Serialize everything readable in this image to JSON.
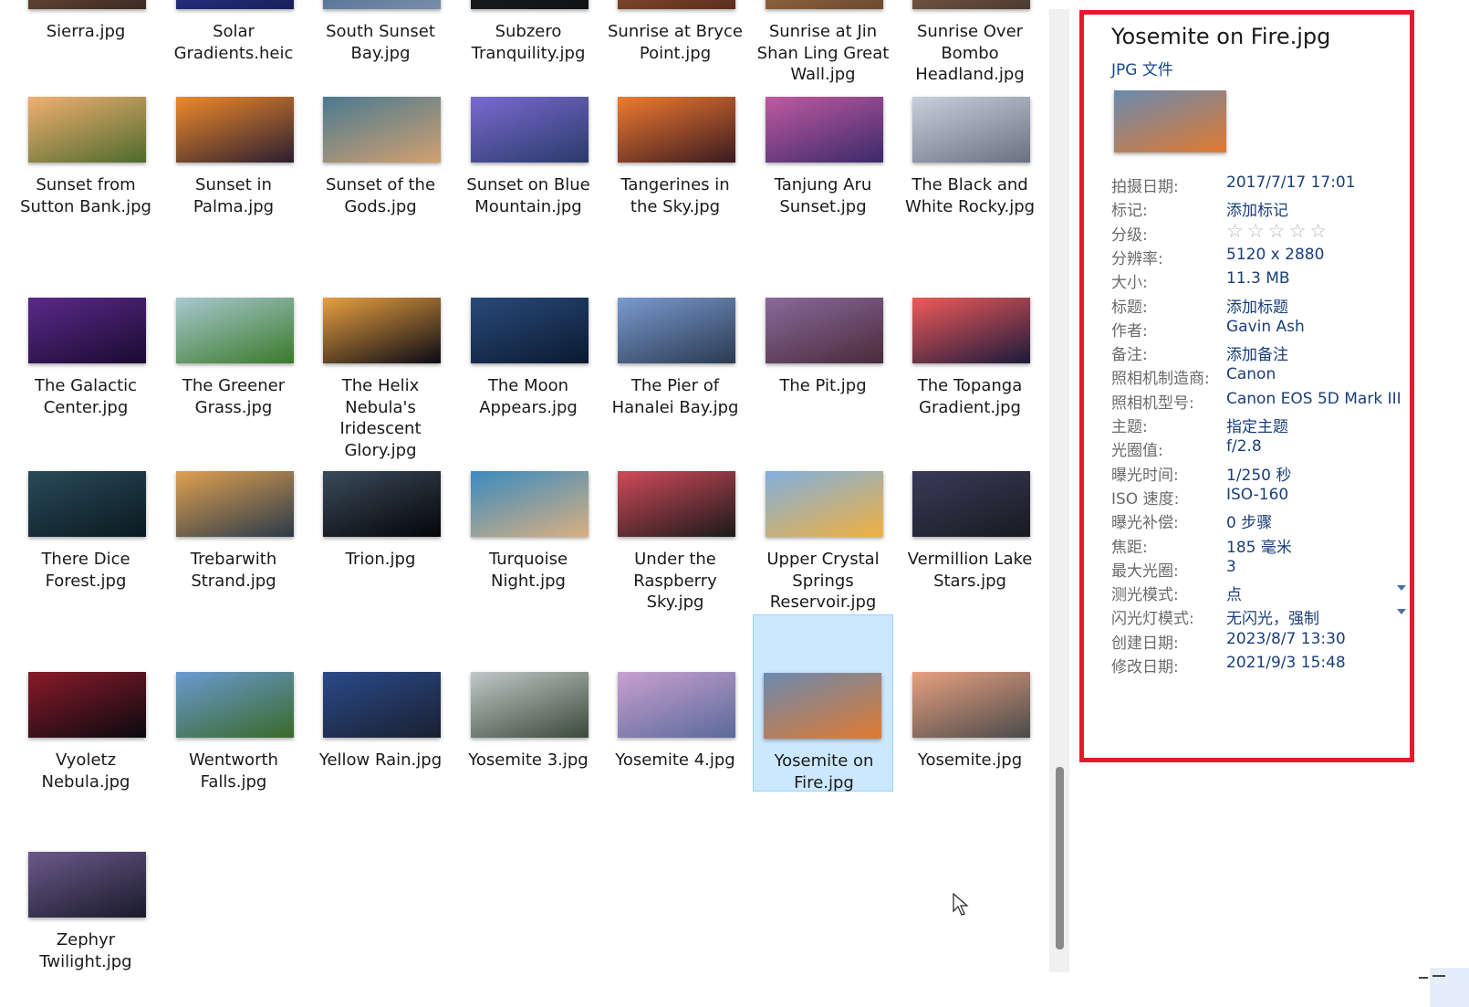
{
  "files": [
    {
      "name": "Sierra.jpg",
      "colors": [
        "#8b5a3c",
        "#3a2a24"
      ]
    },
    {
      "name": "Solar Gradients.heic",
      "colors": [
        "#2c3f9a",
        "#1a1f5c"
      ]
    },
    {
      "name": "South Sunset Bay.jpg",
      "colors": [
        "#3c5b8a",
        "#7890a8"
      ]
    },
    {
      "name": "Subzero Tranquility.jpg",
      "colors": [
        "#202428",
        "#101214"
      ]
    },
    {
      "name": "Sunrise at Bryce Point.jpg",
      "colors": [
        "#a15c3a",
        "#5a2e1c"
      ]
    },
    {
      "name": "Sunrise at Jin Shan Ling Great Wall.jpg",
      "colors": [
        "#b0784a",
        "#6a4a30"
      ]
    },
    {
      "name": "Sunrise Over Bombo Headland.jpg",
      "colors": [
        "#9c6a4e",
        "#4a3a30"
      ]
    },
    {
      "name": "Sunset from Sutton Bank.jpg",
      "colors": [
        "#f0b070",
        "#4e6a2e"
      ]
    },
    {
      "name": "Sunset in Palma.jpg",
      "colors": [
        "#f08a2a",
        "#2a1e30"
      ]
    },
    {
      "name": "Sunset of the Gods.jpg",
      "colors": [
        "#4a7a90",
        "#d2a070"
      ]
    },
    {
      "name": "Sunset on Blue Mountain.jpg",
      "colors": [
        "#7a6ad0",
        "#2a3a6a"
      ]
    },
    {
      "name": "Tangerines in the Sky.jpg",
      "colors": [
        "#f07a30",
        "#3a1a20"
      ]
    },
    {
      "name": "Tanjung Aru Sunset.jpg",
      "colors": [
        "#c05aa0",
        "#3a2a6a"
      ]
    },
    {
      "name": "The Black and White Rocky.jpg",
      "colors": [
        "#c8d0dc",
        "#6a7080"
      ]
    },
    {
      "name": "The Galactic Center.jpg",
      "colors": [
        "#5a2a8a",
        "#1a0a30"
      ]
    },
    {
      "name": "The Greener Grass.jpg",
      "colors": [
        "#a8c8d0",
        "#3a7a2a"
      ]
    },
    {
      "name": "The Helix Nebula's Iridescent Glory.jpg",
      "colors": [
        "#e8a040",
        "#0a0a14"
      ]
    },
    {
      "name": "The Moon Appears.jpg",
      "colors": [
        "#2a4a7a",
        "#0a1a30"
      ]
    },
    {
      "name": "The Pier of Hanalei Bay.jpg",
      "colors": [
        "#7a9ad0",
        "#2a3a50"
      ]
    },
    {
      "name": "The Pit.jpg",
      "colors": [
        "#8a6a9a",
        "#4a2a3a"
      ]
    },
    {
      "name": "The Topanga Gradient.jpg",
      "colors": [
        "#f05a5a",
        "#1a1a3a"
      ]
    },
    {
      "name": "There Dice Forest.jpg",
      "colors": [
        "#2a4a5a",
        "#0a1a20"
      ]
    },
    {
      "name": "Trebarwith Strand.jpg",
      "colors": [
        "#e0a050",
        "#2a3a4a"
      ]
    },
    {
      "name": "Trion.jpg",
      "colors": [
        "#3a4a5a",
        "#050508"
      ]
    },
    {
      "name": "Turquoise Night.jpg",
      "colors": [
        "#3a8ac0",
        "#d8b080"
      ]
    },
    {
      "name": "Under the Raspberry Sky.jpg",
      "colors": [
        "#d04a5a",
        "#1a1a1a"
      ]
    },
    {
      "name": "Upper Crystal Springs Reservoir.jpg",
      "colors": [
        "#80b0e0",
        "#f0b040"
      ]
    },
    {
      "name": "Vermillion Lake Stars.jpg",
      "colors": [
        "#3a3a5a",
        "#1a1a20"
      ]
    },
    {
      "name": "Vyoletz Nebula.jpg",
      "colors": [
        "#8a1a2a",
        "#0a0a10"
      ]
    },
    {
      "name": "Wentworth Falls.jpg",
      "colors": [
        "#6a9ad0",
        "#3a6a2a"
      ]
    },
    {
      "name": "Yellow Rain.jpg",
      "colors": [
        "#2a4a8a",
        "#1a2030"
      ]
    },
    {
      "name": "Yosemite 3.jpg",
      "colors": [
        "#c0c8c8",
        "#3a4a3a"
      ]
    },
    {
      "name": "Yosemite 4.jpg",
      "colors": [
        "#c8a0d0",
        "#5a6a9a"
      ]
    },
    {
      "name": "Yosemite on Fire.jpg",
      "colors": [
        "#6a8ab0",
        "#e07a30"
      ],
      "selected": true
    },
    {
      "name": "Yosemite.jpg",
      "colors": [
        "#e8a080",
        "#4a4a4a"
      ]
    },
    {
      "name": "Zephyr Twilight.jpg",
      "colors": [
        "#6a5a8a",
        "#1a1a2a"
      ]
    }
  ],
  "details": {
    "title": "Yosemite on Fire.jpg",
    "type": "JPG 文件",
    "thumb_colors": [
      "#6a8ab0",
      "#e07a30"
    ],
    "properties": [
      {
        "label": "拍摄日期:",
        "value": "2017/7/17 17:01"
      },
      {
        "label": "标记:",
        "value": "添加标记"
      },
      {
        "label": "分级:",
        "value": "☆☆☆☆☆",
        "kind": "stars"
      },
      {
        "label": "分辨率:",
        "value": "5120 x 2880"
      },
      {
        "label": "大小:",
        "value": "11.3 MB"
      },
      {
        "label": "标题:",
        "value": "添加标题"
      },
      {
        "label": "作者:",
        "value": "Gavin Ash"
      },
      {
        "label": "备注:",
        "value": "添加备注"
      },
      {
        "label": "照相机制造商:",
        "value": "Canon"
      },
      {
        "label": "照相机型号:",
        "value": "Canon EOS 5D Mark III"
      },
      {
        "label": "主题:",
        "value": "指定主题"
      },
      {
        "label": "光圈值:",
        "value": "f/2.8"
      },
      {
        "label": "曝光时间:",
        "value": "1/250 秒"
      },
      {
        "label": "ISO 速度:",
        "value": "ISO-160"
      },
      {
        "label": "曝光补偿:",
        "value": "0 步骤"
      },
      {
        "label": "焦距:",
        "value": "185 毫米"
      },
      {
        "label": "最大光圈:",
        "value": "3"
      },
      {
        "label": "测光模式:",
        "value": "点",
        "kind": "dropdown"
      },
      {
        "label": "闪光灯模式:",
        "value": "无闪光，强制",
        "kind": "dropdown"
      },
      {
        "label": "创建日期:",
        "value": "2023/8/7 13:30"
      },
      {
        "label": "修改日期:",
        "value": "2021/9/3 15:48"
      }
    ]
  },
  "colors": {
    "highlight_border": "#e8192c",
    "selection_bg": "#cce8ff"
  }
}
